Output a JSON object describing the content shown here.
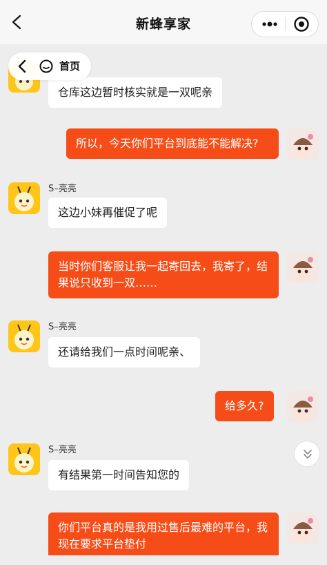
{
  "header": {
    "title": "新蜂享家"
  },
  "home_pill": {
    "label": "首页"
  },
  "messages": [
    {
      "side": "in",
      "text": "仓库这边暂时核实就是一双呢亲"
    },
    {
      "side": "out",
      "text": "所以，今天你们平台到底能不能解决?"
    },
    {
      "side": "in",
      "sender": "S–亮亮",
      "text": "这边小妹再催促了呢"
    },
    {
      "side": "out",
      "text": "当时你们客服让我一起寄回去，我寄了，结果说只收到一双……"
    },
    {
      "side": "in",
      "sender": "S–亮亮",
      "text": "还请给我们一点时间呢亲、"
    },
    {
      "side": "out",
      "text": "给多久?"
    },
    {
      "side": "in",
      "sender": "S–亮亮",
      "text": "有结果第一时间告知您的"
    },
    {
      "side": "out",
      "text": "你们平台真的是我用过售后最难的平台，我现在要求平台垫付"
    }
  ],
  "colors": {
    "outgoing_bubble": "#f64d18",
    "incoming_bubble": "#ffffff",
    "background": "#ededed",
    "bee_avatar": "#ffc61a"
  },
  "icons": [
    "back-arrow-icon",
    "more-dots-icon",
    "target-circle-icon",
    "home-icon",
    "chevron-double-down-icon",
    "bee-avatar-icon",
    "girl-avatar-icon"
  ]
}
